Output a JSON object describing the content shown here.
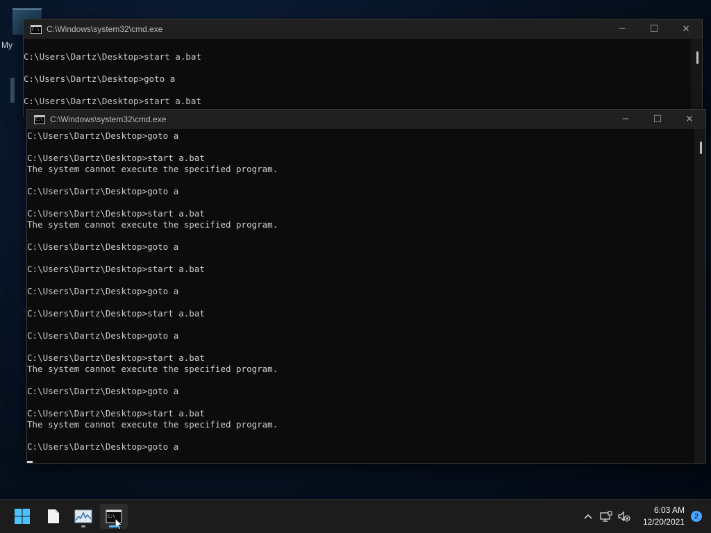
{
  "desktop": {
    "icon_label": "My"
  },
  "window_back": {
    "title": "C:\\Windows\\system32\\cmd.exe",
    "lines": [
      "C:\\Users\\Dartz\\Desktop>start a.bat",
      "",
      "C:\\Users\\Dartz\\Desktop>goto a",
      "",
      "C:\\Users\\Dartz\\Desktop>start a.bat"
    ]
  },
  "window_front": {
    "title": "C:\\Windows\\system32\\cmd.exe",
    "lines": [
      "C:\\Users\\Dartz\\Desktop>goto a",
      "",
      "C:\\Users\\Dartz\\Desktop>start a.bat",
      "The system cannot execute the specified program.",
      "",
      "C:\\Users\\Dartz\\Desktop>goto a",
      "",
      "C:\\Users\\Dartz\\Desktop>start a.bat",
      "The system cannot execute the specified program.",
      "",
      "C:\\Users\\Dartz\\Desktop>goto a",
      "",
      "C:\\Users\\Dartz\\Desktop>start a.bat",
      "",
      "C:\\Users\\Dartz\\Desktop>goto a",
      "",
      "C:\\Users\\Dartz\\Desktop>start a.bat",
      "",
      "C:\\Users\\Dartz\\Desktop>goto a",
      "",
      "C:\\Users\\Dartz\\Desktop>start a.bat",
      "The system cannot execute the specified program.",
      "",
      "C:\\Users\\Dartz\\Desktop>goto a",
      "",
      "C:\\Users\\Dartz\\Desktop>start a.bat",
      "The system cannot execute the specified program.",
      "",
      "C:\\Users\\Dartz\\Desktop>goto a",
      ""
    ]
  },
  "window_buttons": {
    "minimize": "─",
    "maximize": "☐",
    "close": "✕",
    "cmd_icon_text": "C:\\"
  },
  "taskbar": {
    "items": [
      {
        "icon": "windows-start-icon"
      },
      {
        "icon": "notepad-icon"
      },
      {
        "icon": "performance-monitor-icon"
      },
      {
        "icon": "cmd-icon"
      }
    ],
    "tray": {
      "chevron": "^",
      "time": "6:03 AM",
      "date": "12/20/2021",
      "notification_count": "2"
    }
  },
  "colors": {
    "accent": "#4cc2ff",
    "console_text": "#cccccc",
    "console_bg": "#0c0c0c",
    "titlebar": "#202020",
    "taskbar": "#1c1c1c"
  }
}
